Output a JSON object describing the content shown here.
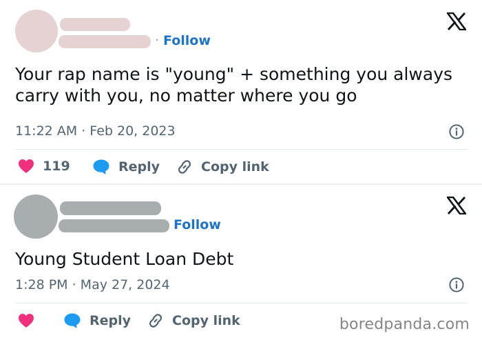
{
  "posts": [
    {
      "avatar_color": "#e5d2d2",
      "redaction_color": "#e5d2d2",
      "separator": "·",
      "follow_label": "Follow",
      "text_line1": "Your rap name is \"young\" + something you always",
      "text_line2": "carry with you, no matter where you go",
      "timestamp": "11:22 AM · Feb 20, 2023",
      "like_count": "119",
      "reply_label": "Reply",
      "copy_link_label": "Copy link"
    },
    {
      "avatar_color": "#a8adad",
      "redaction_color": "#a8adad",
      "follow_label": "Follow",
      "text": "Young Student Loan Debt",
      "timestamp": "1:28 PM · May 27, 2024",
      "reply_label": "Reply",
      "copy_link_label": "Copy link"
    }
  ],
  "colors": {
    "link": "#1d74c6",
    "like": "#f0307b",
    "reply": "#1d9bf0",
    "muted": "#536471"
  },
  "icons": [
    "x-logo-icon",
    "info-icon",
    "heart-icon",
    "speech-bubble-icon",
    "link-icon"
  ],
  "watermark": "boredpanda.com"
}
